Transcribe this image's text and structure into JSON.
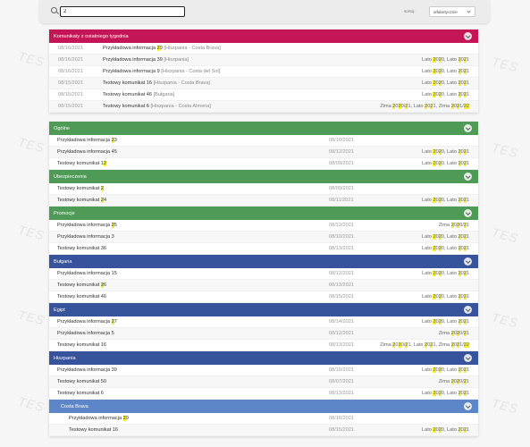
{
  "watermark": "TES",
  "search": {
    "value": "2"
  },
  "sort": {
    "label": "sortuj:",
    "selected": "alfabetycznie"
  },
  "recent": {
    "title": "Komunikaty z ostatniego tygodnia",
    "rows": [
      {
        "date": "08/16/2021",
        "title_parts": [
          "Przykładowa informacja ",
          "29",
          " "
        ],
        "region": "[Hiszpania - Costa Brava]",
        "tags": []
      },
      {
        "date": "08/16/2021",
        "title_parts": [
          "Przykładowa informacja 39 "
        ],
        "region": "[Hiszpania]",
        "tags": [
          "Lato ",
          "20",
          "20, Lato ",
          "2",
          "0",
          "21"
        ]
      },
      {
        "date": "08/16/2021",
        "title_parts": [
          "Przykładowa informacja 9 "
        ],
        "region": "[Hiszpania - Costa del Sol]",
        "tags": [
          "Lato ",
          "20",
          "20, Lato ",
          "2",
          "0",
          "21"
        ]
      },
      {
        "date": "08/15/2021",
        "title_parts": [
          "Testowy komunikat 16 "
        ],
        "region": "[Hiszpania - Costa Brava]",
        "tags": [
          "Lato ",
          "20",
          "20, Lato ",
          "2",
          "0",
          "21"
        ]
      },
      {
        "date": "08/15/2021",
        "title_parts": [
          "Testowy komunikat 46 "
        ],
        "region": "[Bułgaria]",
        "tags": [
          "Lato ",
          "20",
          "20, Lato ",
          "2",
          "0",
          "21"
        ]
      },
      {
        "date": "08/15/2021",
        "title_parts": [
          "Testowy komunikat 6 "
        ],
        "region": "[Hiszpania - Costa Almeria]",
        "tags": [
          "Zima ",
          "2",
          "0",
          "20",
          "/",
          "2",
          "1, Lato ",
          "20",
          "21, Zima ",
          "20",
          "21/",
          "22"
        ]
      }
    ]
  },
  "sections": [
    {
      "key": "ogolne",
      "title": "Ogólne",
      "color": "green",
      "rows": [
        {
          "title": "Przykładowa informacja ",
          "hl": "23",
          "date": "08/10/2021",
          "tags": ""
        },
        {
          "title": "Przykładowa informacja 45",
          "hl": "",
          "date": "08/12/2021",
          "tags": "Lato 2020, Lato 2021"
        },
        {
          "title": "Testowy komunikat 1",
          "hl": "2",
          "date": "08/09/2021",
          "tags": "Lato 2020, Lato 2021"
        }
      ]
    },
    {
      "key": "ubezpieczenia",
      "title": "Ubezpieczenia",
      "color": "green",
      "rows": [
        {
          "title": "Testowy komunikat ",
          "hl": "2",
          "date": "08/09/2021",
          "tags": ""
        },
        {
          "title": "Testowy komunikat ",
          "hl": "24",
          "date": "08/11/2021",
          "tags": "Lato 2020, Lato 2021"
        }
      ]
    },
    {
      "key": "promocje",
      "title": "Promocje",
      "color": "green",
      "rows": [
        {
          "title": "Przykładowa informacja ",
          "hl": "25",
          "date": "08/12/2021",
          "tags": "Zima 2020/21"
        },
        {
          "title": "Przykładowa informacja 3",
          "hl": "",
          "date": "08/10/2021",
          "tags": "Lato 2020, Lato 2021"
        },
        {
          "title": "Testowy komunikat 36",
          "hl": "",
          "date": "08/13/2021",
          "tags": "Lato 2020, Lato 2021"
        }
      ]
    },
    {
      "key": "bulgaria",
      "title": "Bułgaria",
      "color": "blue",
      "rows": [
        {
          "title": "Przykładowa informacja 15",
          "hl": "",
          "date": "08/12/2021",
          "tags": "Lato 2020, Lato 2021"
        },
        {
          "title": "Testowy komunikat ",
          "hl": "26",
          "date": "08/13/2021",
          "tags": ""
        },
        {
          "title": "Testowy komunikat 46",
          "hl": "",
          "date": "08/15/2021",
          "tags": "Lato 2020, Lato 2021"
        }
      ]
    },
    {
      "key": "egipt",
      "title": "Egipt",
      "color": "blue",
      "rows": [
        {
          "title": "Przykładowa informacja ",
          "hl": "27",
          "date": "08/14/2021",
          "tags": "Lato 2020, Lato 2021"
        },
        {
          "title": "Przykładowa informacja 5",
          "hl": "",
          "date": "08/12/2021",
          "tags": "Zima 2020/21"
        },
        {
          "title": "Testowy komunikat 16",
          "hl": "",
          "date": "08/13/2021",
          "tags": "Zima 2020/21, Lato 2021, Zima 2021/22"
        }
      ]
    },
    {
      "key": "hiszpania",
      "title": "Hiszpania",
      "color": "blue",
      "rows": [
        {
          "title": "Przykładowa informacja 39",
          "hl": "",
          "date": "08/16/2021",
          "tags": "Lato 2020, Lato 2021"
        },
        {
          "title": "Testowy komunikat 50",
          "hl": "",
          "date": "08/07/2021",
          "tags": "Zima 2020/21"
        },
        {
          "title": "Testowy komunikat 6",
          "hl": "",
          "date": "08/13/2021",
          "tags": "Lato 2020, Lato 2021"
        }
      ]
    },
    {
      "key": "costa-brava",
      "title": "Costa Brava",
      "color": "lightblue",
      "indent": true,
      "rows": [
        {
          "title": "Przykładowa informacja ",
          "hl": "29",
          "date": "08/16/2021",
          "tags": ""
        },
        {
          "title": "Testowy komunikat 16",
          "hl": "",
          "date": "08/15/2021",
          "tags": "Lato 2020, Lato 2021"
        }
      ]
    }
  ]
}
